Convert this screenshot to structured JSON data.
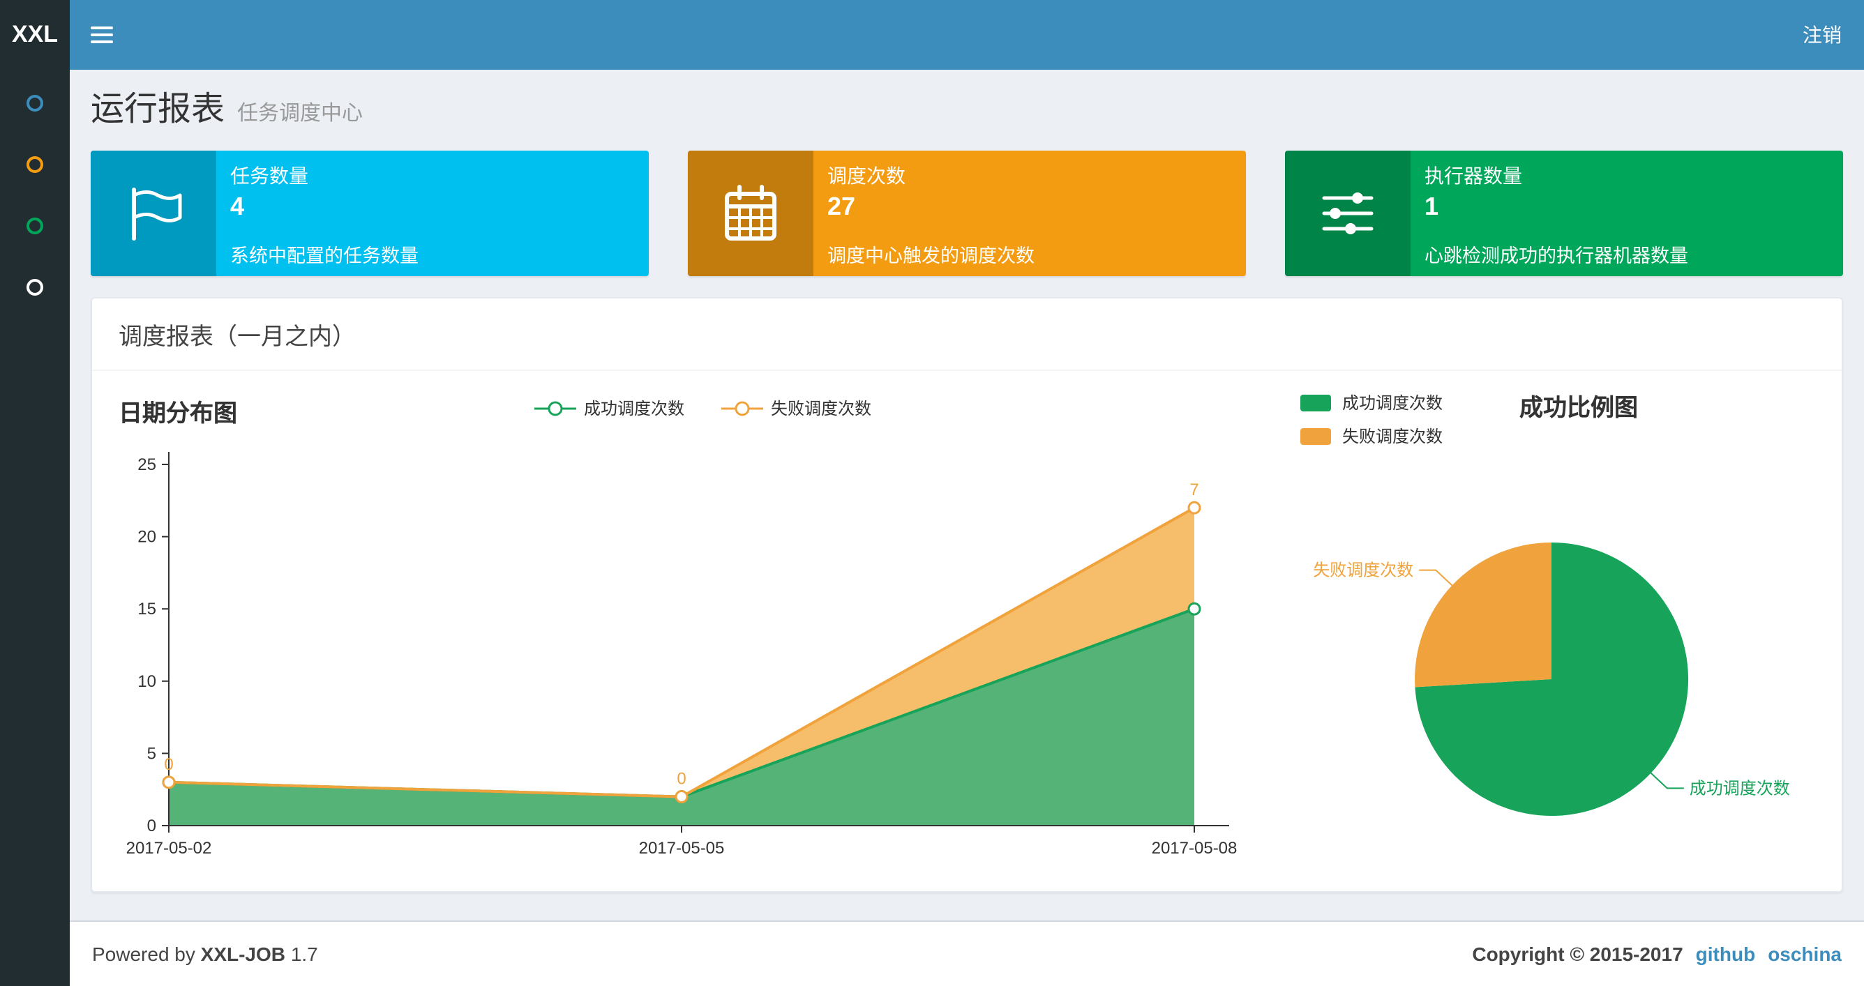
{
  "navbar": {
    "logo": "XXL",
    "logout_label": "注销"
  },
  "sidebar": {
    "items": [
      {
        "icon": "circle-icon",
        "color": "#3c8dbc"
      },
      {
        "icon": "circle-icon",
        "color": "#f39c12"
      },
      {
        "icon": "circle-icon",
        "color": "#00a65a"
      },
      {
        "icon": "circle-icon",
        "color": "#ffffff"
      }
    ]
  },
  "page_header": {
    "title": "运行报表",
    "subtitle": "任务调度中心"
  },
  "info_boxes": [
    {
      "label": "任务数量",
      "value": "4",
      "description": "系统中配置的任务数量",
      "color": "#00c0ef",
      "icon": "flag-icon"
    },
    {
      "label": "调度次数",
      "value": "27",
      "description": "调度中心触发的调度次数",
      "color": "#f39c12",
      "icon": "calendar-icon"
    },
    {
      "label": "执行器数量",
      "value": "1",
      "description": "心跳检测成功的执行器机器数量",
      "color": "#00a65a",
      "icon": "sliders-icon"
    }
  ],
  "panel": {
    "title": "调度报表（一月之内）"
  },
  "chart_data": [
    {
      "type": "area",
      "title": "日期分布图",
      "stacked": true,
      "grid": false,
      "legend_position": "top-center",
      "x": [
        "2017-05-02",
        "2017-05-05",
        "2017-05-08"
      ],
      "series": [
        {
          "name": "成功调度次数",
          "color": "#17a45a",
          "area_color": "#55b377",
          "values": [
            3,
            2,
            15
          ]
        },
        {
          "name": "失败调度次数",
          "color": "#f0a33c",
          "area_color": "#f6be6a",
          "values": [
            0,
            0,
            7
          ],
          "point_labels": [
            "0",
            "0",
            "7"
          ]
        }
      ],
      "ylim": [
        0,
        25
      ],
      "yticks": [
        0,
        5,
        10,
        15,
        20,
        25
      ]
    },
    {
      "type": "pie",
      "title": "成功比例图",
      "legend_position": "top-left",
      "slices": [
        {
          "name": "成功调度次数",
          "value": 20,
          "color": "#17a45a"
        },
        {
          "name": "失败调度次数",
          "value": 7,
          "color": "#f0a33c"
        }
      ]
    }
  ],
  "footer": {
    "powered_by": "Powered by",
    "product": "XXL-JOB",
    "version": "1.7",
    "copyright": "Copyright © 2015-2017",
    "links": [
      {
        "label": "github"
      },
      {
        "label": "oschina"
      }
    ]
  }
}
